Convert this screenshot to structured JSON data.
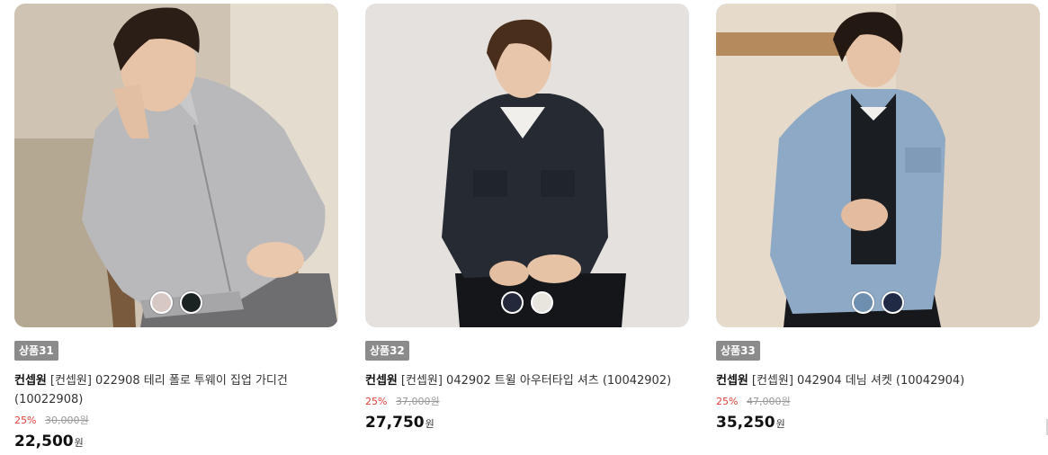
{
  "products": [
    {
      "badge": "상품31",
      "brand": "컨셉원",
      "title": "[컨셉원] 022908 테리 폴로 투웨이 집업 가디건 (10022908)",
      "discount": "25%",
      "original_price": "30,000원",
      "price": "22,500",
      "currency": "원",
      "swatches": [
        "#d8c8c4",
        "#1b2322"
      ]
    },
    {
      "badge": "상품32",
      "brand": "컨셉원",
      "title": "[컨셉원] 042902 트윌 아우터타입 셔츠 (10042902)",
      "discount": "25%",
      "original_price": "37,000원",
      "price": "27,750",
      "currency": "원",
      "swatches": [
        "#23283a",
        "#e8e4de"
      ]
    },
    {
      "badge": "상품33",
      "brand": "컨셉원",
      "title": "[컨셉원] 042904 데님 셔켓 (10042904)",
      "discount": "25%",
      "original_price": "47,000원",
      "price": "35,250",
      "currency": "원",
      "swatches": [
        "#6f8fb0",
        "#202a45"
      ]
    }
  ],
  "colors": {
    "discount": "#e0403a",
    "badge_bg": "#8b8b8b"
  }
}
